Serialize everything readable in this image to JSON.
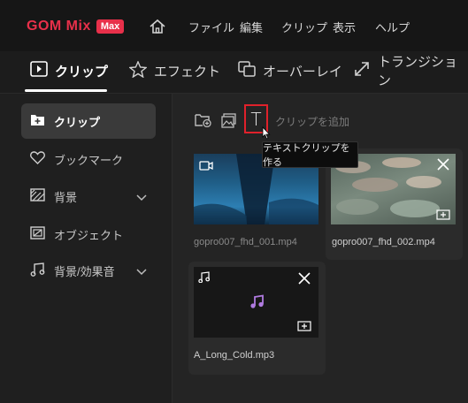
{
  "app": {
    "logo_text": "GOM Mix",
    "logo_badge": "Max"
  },
  "menu": [
    "ファイル",
    "編集",
    "クリップ",
    "表示",
    "ヘルプ"
  ],
  "tabs": [
    {
      "label": "クリップ",
      "icon": "clip-icon",
      "active": true
    },
    {
      "label": "エフェクト",
      "icon": "star-icon",
      "active": false
    },
    {
      "label": "オーバーレイ",
      "icon": "overlay-icon",
      "active": false
    },
    {
      "label": "トランジション",
      "icon": "transition-icon",
      "active": false
    }
  ],
  "sidebar": {
    "items": [
      {
        "label": "クリップ",
        "icon": "clip-add-icon",
        "active": true
      },
      {
        "label": "ブックマーク",
        "icon": "heart-icon"
      },
      {
        "label": "背景",
        "icon": "background-icon",
        "expandable": true
      },
      {
        "label": "オブジェクト",
        "icon": "object-icon"
      },
      {
        "label": "背景/効果音",
        "icon": "music-icon",
        "expandable": true
      }
    ]
  },
  "toolbar": {
    "add_clip_label": "クリップを追加",
    "text_button_glyph": "T",
    "tooltip": "テキストクリップを作る"
  },
  "clips": [
    {
      "name": "gopro007_fhd_001.mp4",
      "type": "video"
    },
    {
      "name": "gopro007_fhd_002.mp4",
      "type": "video"
    },
    {
      "name": "A_Long_Cold.mp3",
      "type": "audio"
    }
  ],
  "colors": {
    "accent_red": "#e0212b",
    "logo_badge": "#e8304a",
    "music_purple": "#b07be0"
  }
}
